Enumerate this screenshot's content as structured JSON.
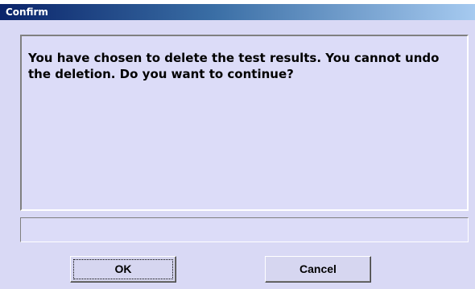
{
  "window": {
    "title": "Confirm"
  },
  "message": {
    "text": "You have chosen to  delete the test results. You cannot undo the deletion. Do you want to continue?"
  },
  "status_field": {
    "value": ""
  },
  "buttons": {
    "ok_label": "OK",
    "cancel_label": "Cancel"
  },
  "colors": {
    "dialog_background": "#d9d9f5",
    "titlebar_start": "#0a246a",
    "titlebar_end": "#a6caf0"
  }
}
